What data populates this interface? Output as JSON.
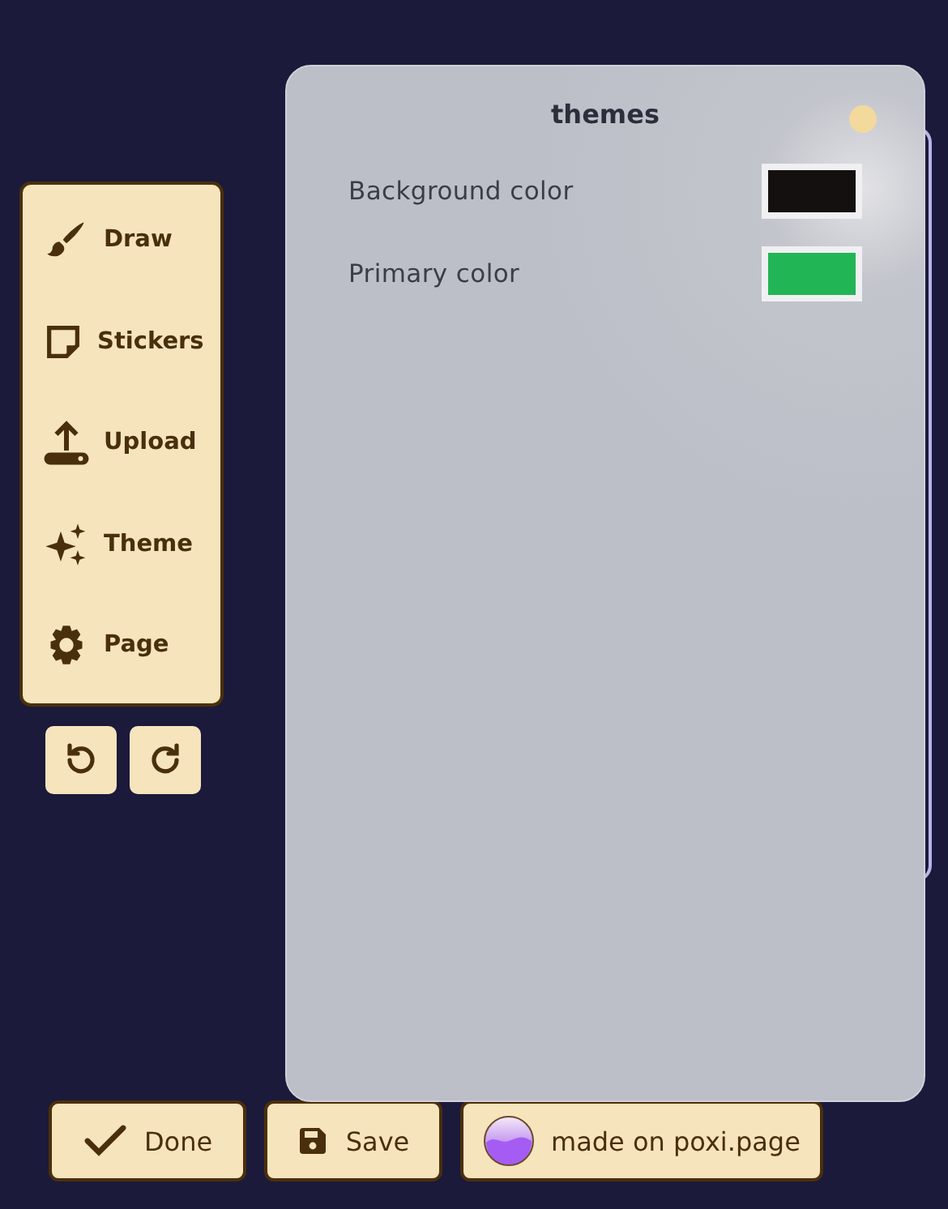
{
  "tools": [
    {
      "kind": "draw",
      "label": "Draw"
    },
    {
      "kind": "stickers",
      "label": "Stickers"
    },
    {
      "kind": "upload",
      "label": "Upload"
    },
    {
      "kind": "theme",
      "label": "Theme"
    },
    {
      "kind": "page",
      "label": "Page"
    }
  ],
  "history": [
    {
      "kind": "undo"
    },
    {
      "kind": "redo"
    }
  ],
  "panel": {
    "title": "themes",
    "settings": [
      {
        "label": "Background color",
        "color": "#151010"
      },
      {
        "label": "Primary color",
        "color": "#22b556"
      }
    ]
  },
  "actions": [
    {
      "kind": "done",
      "label": "Done"
    },
    {
      "kind": "save",
      "label": "Save"
    },
    {
      "kind": "poxi",
      "label": "made on poxi.page"
    }
  ]
}
